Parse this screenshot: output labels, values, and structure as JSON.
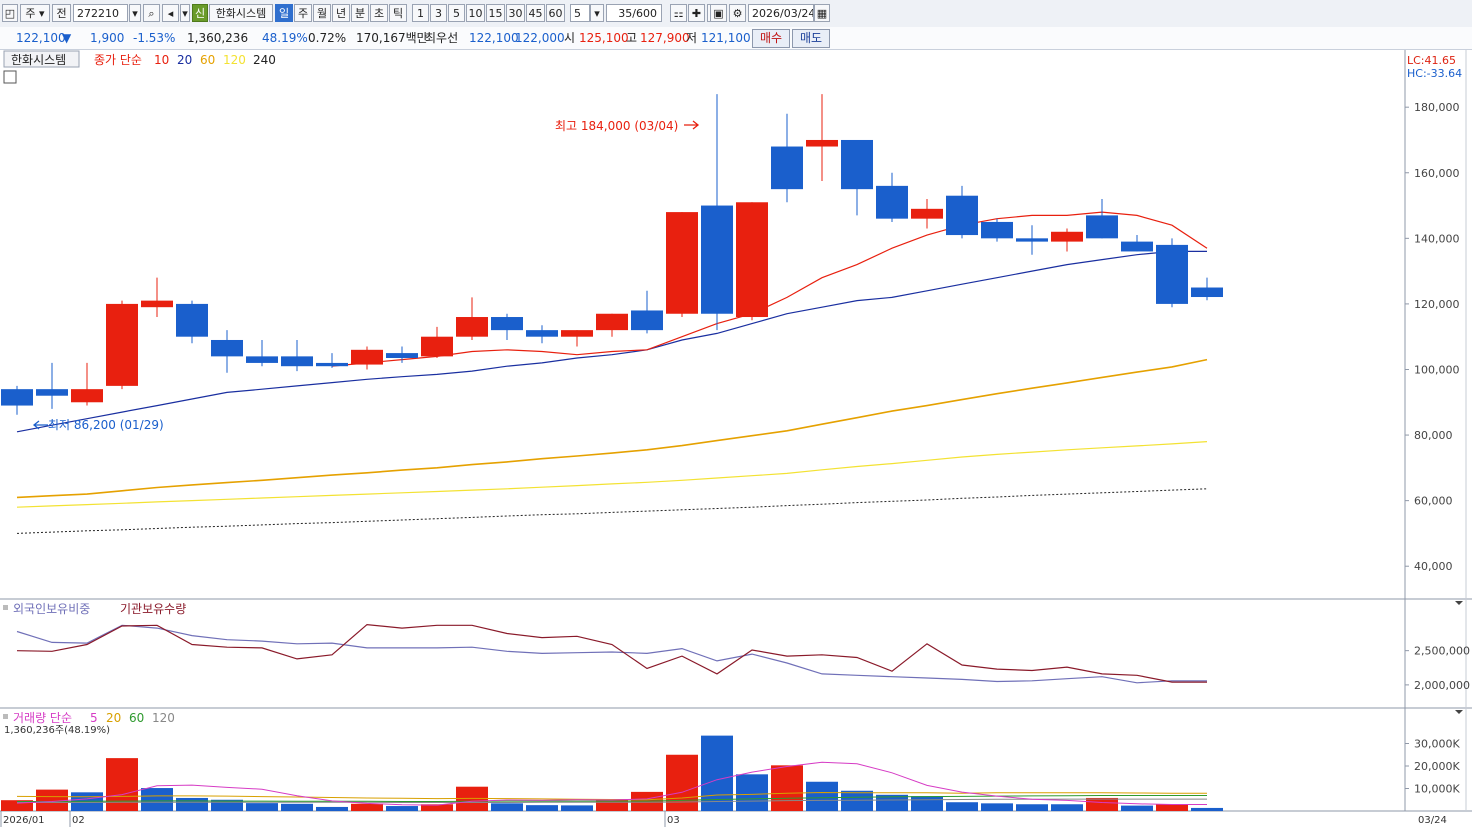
{
  "toolbar": {
    "market": "주",
    "scope": "전",
    "code": "272210",
    "mode_badge": "신",
    "name": "한화시스템",
    "periods": [
      "일",
      "주",
      "월",
      "년",
      "분",
      "초",
      "틱"
    ],
    "period_active": 0,
    "intervals": [
      "1",
      "3",
      "5",
      "10",
      "15",
      "30",
      "45",
      "60"
    ],
    "interval_value": "5",
    "count": "35/600",
    "date": "2026/03/24"
  },
  "quote": {
    "price": "122,100",
    "change": "1,900",
    "change_pct": "-1.53%",
    "volume": "1,360,236",
    "volume_ratio": "48.19%",
    "turnover": "0.72%",
    "amount": "170,167백만",
    "best_label": "최우선",
    "best_ask": "122,100",
    "best_bid": "122,000",
    "open_label": "시",
    "open": "125,100",
    "high_label": "고",
    "high": "127,900",
    "low_label": "저",
    "low": "121,100",
    "buy_label": "매수",
    "sell_label": "매도"
  },
  "colors": {
    "up": "#e8200f",
    "down": "#1a5fcc",
    "ma10": "#e8200f",
    "ma20": "#1a2fa0",
    "ma60": "#e5a100",
    "ma120": "#f3e233",
    "ma240": "#222222",
    "foreign": "#7070b8",
    "institution": "#8a1a2a",
    "vol_ma5": "#d63cc5",
    "vol_ma20": "#d8a000",
    "vol_ma60": "#2e9a2e",
    "vol_ma120": "#888888"
  },
  "chart_data": [
    {
      "type": "candlestick",
      "panel": "price",
      "legend": {
        "name": "한화시스템",
        "close_label": "종가",
        "ma_type": "단순",
        "periods": [
          "10",
          "20",
          "60",
          "120",
          "240"
        ]
      },
      "lc_label": "LC:41.65",
      "hc_label": "HC:-33.64",
      "high_annotation": "최고 184,000 (03/04)",
      "low_annotation": "최저 86,200 (01/29)",
      "ylim": [
        30000,
        195000
      ],
      "yticks": [
        40000,
        60000,
        80000,
        100000,
        120000,
        140000,
        160000,
        180000
      ],
      "ytick_labels": [
        "40,000",
        "60,000",
        "80,000",
        "100,000",
        "120,000",
        "140,000",
        "160,000",
        "180,000"
      ],
      "candles": [
        {
          "o": 94000,
          "h": 95000,
          "l": 86200,
          "c": 89000
        },
        {
          "o": 94000,
          "h": 102000,
          "l": 88000,
          "c": 92000
        },
        {
          "o": 90000,
          "h": 102000,
          "l": 89000,
          "c": 94000
        },
        {
          "o": 95000,
          "h": 121000,
          "l": 94000,
          "c": 120000
        },
        {
          "o": 119000,
          "h": 128000,
          "l": 116000,
          "c": 121000
        },
        {
          "o": 120000,
          "h": 121000,
          "l": 108000,
          "c": 110000
        },
        {
          "o": 109000,
          "h": 112000,
          "l": 99000,
          "c": 104000
        },
        {
          "o": 104000,
          "h": 109000,
          "l": 101000,
          "c": 102000
        },
        {
          "o": 104000,
          "h": 109000,
          "l": 99500,
          "c": 101000
        },
        {
          "o": 102000,
          "h": 105000,
          "l": 100500,
          "c": 101000
        },
        {
          "o": 101500,
          "h": 107000,
          "l": 100000,
          "c": 106000
        },
        {
          "o": 105000,
          "h": 107000,
          "l": 102000,
          "c": 103500
        },
        {
          "o": 104000,
          "h": 113000,
          "l": 103500,
          "c": 110000
        },
        {
          "o": 110000,
          "h": 122000,
          "l": 109000,
          "c": 116000
        },
        {
          "o": 116000,
          "h": 117000,
          "l": 109000,
          "c": 112000
        },
        {
          "o": 112000,
          "h": 113500,
          "l": 108000,
          "c": 110000
        },
        {
          "o": 110000,
          "h": 112000,
          "l": 107000,
          "c": 112000
        },
        {
          "o": 112000,
          "h": 117000,
          "l": 110000,
          "c": 117000
        },
        {
          "o": 118000,
          "h": 124000,
          "l": 111000,
          "c": 112000
        },
        {
          "o": 117000,
          "h": 148000,
          "l": 116000,
          "c": 148000
        },
        {
          "o": 150000,
          "h": 184000,
          "l": 112000,
          "c": 117000
        },
        {
          "o": 116000,
          "h": 151000,
          "l": 115000,
          "c": 151000
        },
        {
          "o": 168000,
          "h": 178000,
          "l": 151000,
          "c": 155000
        },
        {
          "o": 168000,
          "h": 184000,
          "l": 157500,
          "c": 170000
        },
        {
          "o": 170000,
          "h": 170000,
          "l": 147000,
          "c": 155000
        },
        {
          "o": 156000,
          "h": 160000,
          "l": 145000,
          "c": 146000
        },
        {
          "o": 146000,
          "h": 152000,
          "l": 143000,
          "c": 149000
        },
        {
          "o": 153000,
          "h": 156000,
          "l": 140000,
          "c": 141000
        },
        {
          "o": 145000,
          "h": 146000,
          "l": 139000,
          "c": 140000
        },
        {
          "o": 140000,
          "h": 144000,
          "l": 135000,
          "c": 139000
        },
        {
          "o": 139000,
          "h": 143000,
          "l": 136000,
          "c": 142000
        },
        {
          "o": 147000,
          "h": 152000,
          "l": 140000,
          "c": 140000
        },
        {
          "o": 139000,
          "h": 141000,
          "l": 136000,
          "c": 136000
        },
        {
          "o": 138000,
          "h": 140000,
          "l": 119000,
          "c": 120000
        },
        {
          "o": 125000,
          "h": 128000,
          "l": 121100,
          "c": 122100
        }
      ],
      "ma10": [
        null,
        null,
        null,
        null,
        null,
        null,
        null,
        null,
        null,
        101000,
        102000,
        103000,
        104000,
        105500,
        106000,
        105500,
        104500,
        105500,
        106000,
        110000,
        114000,
        117000,
        122000,
        128000,
        132000,
        137000,
        141000,
        144000,
        146000,
        147000,
        147000,
        148000,
        147000,
        144000,
        137000
      ],
      "ma20": [
        81000,
        83000,
        85000,
        87000,
        89000,
        91000,
        93000,
        94000,
        95000,
        96000,
        97000,
        97800,
        98500,
        99500,
        101000,
        102000,
        103500,
        104500,
        106000,
        109000,
        111000,
        114000,
        117000,
        119000,
        121000,
        122000,
        124000,
        126000,
        128000,
        130000,
        132000,
        133500,
        135000,
        136000,
        136000
      ],
      "ma60": [
        61000,
        61500,
        62000,
        63000,
        64000,
        64800,
        65500,
        66200,
        67000,
        67800,
        68500,
        69300,
        70000,
        71000,
        71800,
        72800,
        73600,
        74500,
        75500,
        76800,
        78300,
        79800,
        81300,
        83300,
        85300,
        87300,
        89000,
        90800,
        92600,
        94300,
        95900,
        97600,
        99200,
        100800,
        103000
      ],
      "ma120": [
        58000,
        58400,
        58800,
        59200,
        59600,
        60000,
        60400,
        60800,
        61200,
        61600,
        62000,
        62400,
        62800,
        63200,
        63600,
        64100,
        64600,
        65100,
        65600,
        66200,
        66900,
        67600,
        68300,
        69400,
        70400,
        71300,
        72300,
        73300,
        74100,
        74800,
        75500,
        76100,
        76700,
        77300,
        78000
      ],
      "ma240": [
        50000,
        50400,
        50800,
        51100,
        51500,
        51900,
        52200,
        52600,
        53000,
        53300,
        53700,
        54100,
        54500,
        54900,
        55300,
        55700,
        56000,
        56400,
        56800,
        57200,
        57600,
        58000,
        58500,
        58900,
        59400,
        59800,
        60200,
        60700,
        61100,
        61600,
        62000,
        62400,
        62800,
        63200,
        63600
      ]
    },
    {
      "type": "line",
      "panel": "ownership",
      "legend": [
        "외국인보유비중",
        "기관보유수량"
      ],
      "yticks": [
        2000000,
        2500000
      ],
      "ytick_labels": [
        "2,000,000",
        "2,500,000"
      ],
      "ylim": [
        1750000,
        3050000
      ],
      "foreign": [
        2780000,
        2620000,
        2610000,
        2870000,
        2830000,
        2720000,
        2660000,
        2640000,
        2600000,
        2610000,
        2540000,
        2540000,
        2540000,
        2550000,
        2490000,
        2460000,
        2470000,
        2480000,
        2460000,
        2530000,
        2350000,
        2450000,
        2320000,
        2160000,
        2140000,
        2120000,
        2100000,
        2080000,
        2050000,
        2060000,
        2090000,
        2120000,
        2030000,
        2060000,
        2060000
      ],
      "institution": [
        2500000,
        2490000,
        2590000,
        2860000,
        2870000,
        2590000,
        2550000,
        2540000,
        2380000,
        2440000,
        2880000,
        2830000,
        2870000,
        2870000,
        2750000,
        2690000,
        2710000,
        2590000,
        2240000,
        2420000,
        2160000,
        2510000,
        2420000,
        2440000,
        2400000,
        2200000,
        2600000,
        2290000,
        2230000,
        2210000,
        2260000,
        2160000,
        2140000,
        2040000,
        2040000
      ]
    },
    {
      "type": "bar",
      "panel": "volume",
      "legend": {
        "name": "거래량",
        "ma_type": "단순",
        "periods": [
          "5",
          "20",
          "60",
          "120"
        ]
      },
      "last_label": "1,360,236주(48.19%)",
      "ylim": [
        0,
        36000
      ],
      "yticks": [
        10000,
        20000,
        30000
      ],
      "ytick_labels": [
        "10,000K",
        "20,000K",
        "30,000K"
      ],
      "volumes_k": [
        4800,
        9500,
        8300,
        23500,
        10200,
        5800,
        5000,
        3500,
        3200,
        1800,
        3200,
        2200,
        3000,
        10800,
        3400,
        2600,
        2500,
        5300,
        8500,
        25000,
        33500,
        16300,
        20300,
        13000,
        9000,
        7200,
        6600,
        3900,
        3400,
        3000,
        3000,
        5800,
        2400,
        2900,
        1360
      ],
      "up": [
        true,
        true,
        false,
        true,
        false,
        false,
        false,
        false,
        false,
        false,
        true,
        false,
        true,
        true,
        false,
        false,
        false,
        true,
        true,
        true,
        false,
        false,
        true,
        false,
        false,
        false,
        false,
        false,
        false,
        false,
        false,
        true,
        false,
        true,
        false
      ],
      "ma5": [
        3500,
        4200,
        5400,
        7300,
        11200,
        11500,
        10500,
        9700,
        6800,
        4500,
        3400,
        2800,
        2600,
        4300,
        4900,
        4800,
        5000,
        4900,
        5400,
        8300,
        13900,
        17300,
        19800,
        21700,
        21000,
        17000,
        11400,
        8400,
        6600,
        5200,
        4700,
        3800,
        3200,
        2900,
        2900
      ],
      "ma20": [
        6500,
        6400,
        6300,
        6500,
        6700,
        6700,
        6600,
        6400,
        6200,
        6000,
        5800,
        5700,
        5500,
        5600,
        5500,
        5400,
        5200,
        5100,
        5000,
        5800,
        7100,
        7400,
        7900,
        8200,
        8100,
        8100,
        8100,
        7900,
        8100,
        8100,
        8100,
        8100,
        8000,
        7900,
        7900
      ],
      "ma60": [
        4200,
        4200,
        4300,
        4400,
        4500,
        4500,
        4400,
        4400,
        4300,
        4300,
        4300,
        4200,
        4200,
        4300,
        4400,
        4400,
        4400,
        4400,
        4400,
        4700,
        5100,
        5400,
        5700,
        5900,
        6100,
        6300,
        6400,
        6500,
        6600,
        6700,
        6800,
        6900,
        6900,
        6900,
        6900
      ],
      "ma120": [
        3800,
        3800,
        3800,
        3900,
        3900,
        3900,
        3900,
        3900,
        3900,
        3900,
        3900,
        3800,
        3800,
        3800,
        3800,
        3900,
        3900,
        3900,
        3900,
        4000,
        4200,
        4400,
        4600,
        4700,
        4800,
        4900,
        5000,
        5100,
        5200,
        5200,
        5300,
        5300,
        5300,
        5300,
        5300
      ]
    }
  ],
  "xaxis": {
    "labels": [
      {
        "i": 0,
        "text": "2026/01"
      },
      {
        "i": 2,
        "text": "02"
      },
      {
        "i": 19,
        "text": "03"
      }
    ],
    "right_label": "03/24"
  }
}
